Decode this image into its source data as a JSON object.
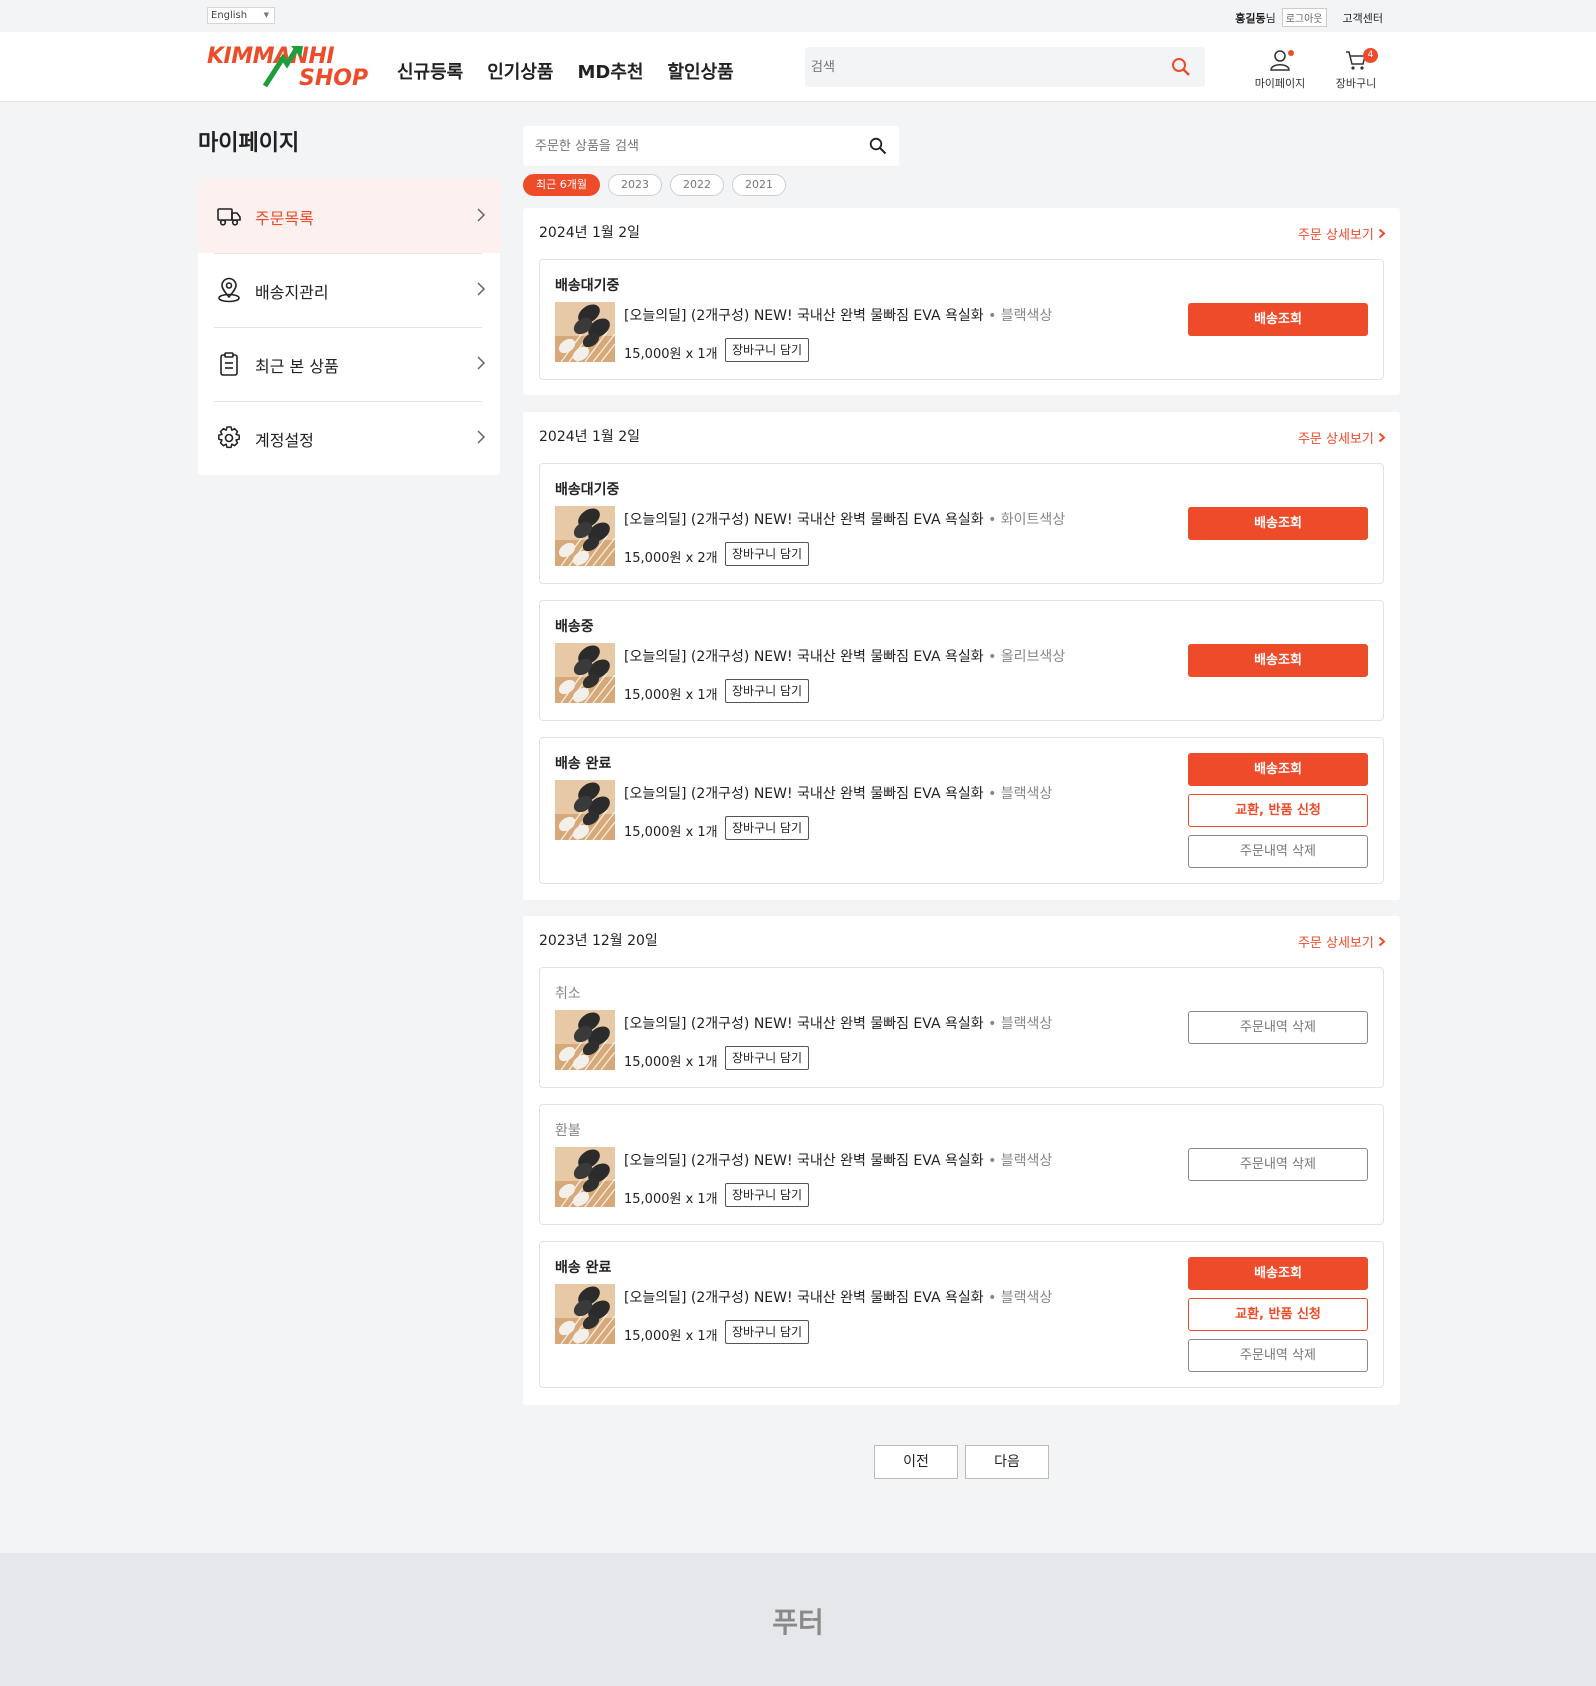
{
  "topbar": {
    "language": "English",
    "user_name": "홍길동",
    "user_suffix": "님",
    "logout": "로그아웃",
    "customer_center": "고객센터"
  },
  "header": {
    "logo_top": "KIMMANHI",
    "logo_bottom": "SHOP",
    "nav": [
      "신규등록",
      "인기상품",
      "MD추천",
      "할인상품"
    ],
    "search_placeholder": "검색",
    "mypage_label": "마이페이지",
    "cart_label": "장바구니",
    "cart_count": "4"
  },
  "colors": {
    "accent": "#ee4b2b",
    "logo_green": "#1f9d3a"
  },
  "page_title": "마이페이지",
  "sidebar": {
    "items": [
      {
        "label": "주문목록",
        "icon": "truck-icon",
        "active": true
      },
      {
        "label": "배송지관리",
        "icon": "map-pin-icon",
        "active": false
      },
      {
        "label": "최근 본 상품",
        "icon": "clipboard-icon",
        "active": false
      },
      {
        "label": "계정설정",
        "icon": "gear-icon",
        "active": false
      }
    ]
  },
  "order_search": {
    "placeholder": "주문한 상품을 검색"
  },
  "filters": [
    "최근 6개월",
    "2023",
    "2022",
    "2021"
  ],
  "detail_link": "주문 상세보기",
  "product": {
    "name": "[오늘의딜] (2개구성) NEW! 국내산 완벽 물빠짐 EVA 욕실화",
    "separator": "•"
  },
  "buttons": {
    "add_cart": "장바구니 담기",
    "track": "배송조회",
    "exchange": "교환, 반품 신청",
    "delete": "주문내역 삭제"
  },
  "groups": [
    {
      "date": "2024년 1월 2일",
      "orders": [
        {
          "status": "배송대기중",
          "option": "블랙색상",
          "price": "15,000원 x 1개"
        }
      ]
    },
    {
      "date": "2024년 1월 2일",
      "orders": [
        {
          "status": "배송대기중",
          "option": "화이트색상",
          "price": "15,000원 x 2개"
        },
        {
          "status": "배송중",
          "option": "올리브색상",
          "price": "15,000원 x 1개"
        },
        {
          "status": "배송 완료",
          "option": "블랙색상",
          "price": "15,000원 x 1개"
        }
      ]
    },
    {
      "date": "2023년 12월 20일",
      "orders": [
        {
          "status": "취소",
          "option": "블랙색상",
          "price": "15,000원 x 1개"
        },
        {
          "status": "환불",
          "option": "블랙색상",
          "price": "15,000원 x 1개"
        },
        {
          "status": "배송 완료",
          "option": "블랙색상",
          "price": "15,000원 x 1개"
        }
      ]
    }
  ],
  "pagination": {
    "prev": "이전",
    "next": "다음"
  },
  "footer": "푸터"
}
